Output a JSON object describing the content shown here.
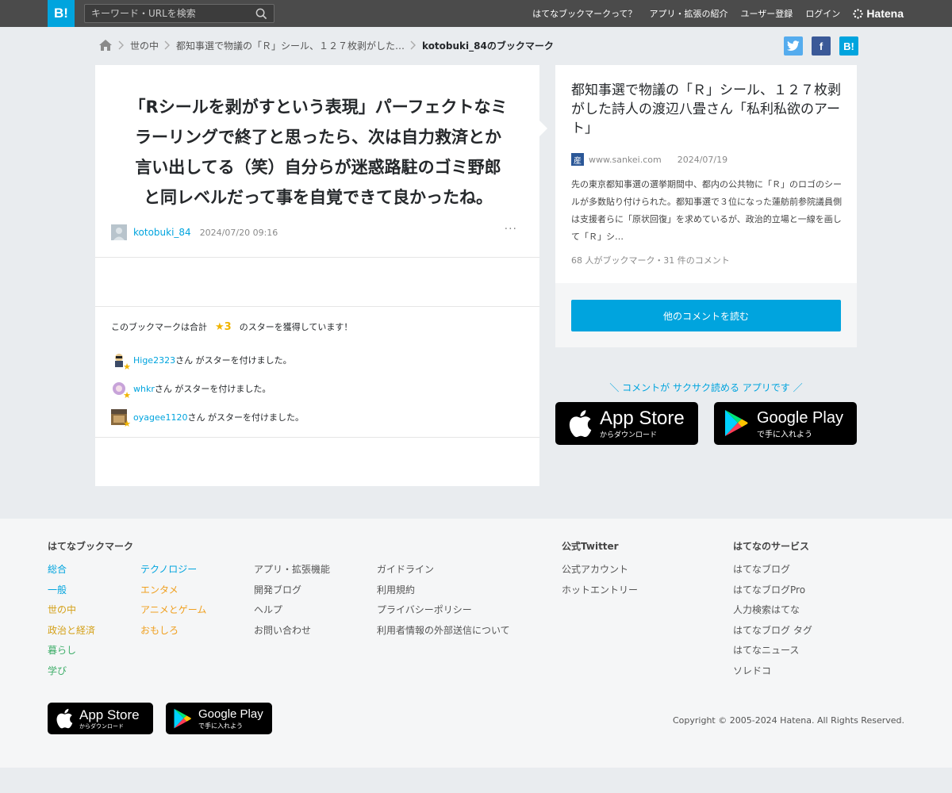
{
  "header": {
    "logo": "B!",
    "search_placeholder": "キーワード・URLを検索",
    "nav": [
      "はてなブックマークって？",
      "アプリ・拡張の紹介",
      "ユーザー登録",
      "ログイン"
    ],
    "brand": "Hatena"
  },
  "breadcrumb": {
    "items": [
      "世の中",
      "都知事選で物議の「Ｒ」シール、１２７枚剥がした…"
    ],
    "current": "kotobuki_84のブックマーク"
  },
  "share": {
    "facebook": "f",
    "hatena": "B!"
  },
  "comment": {
    "text": "「Rシールを剥がすという表現」パーフェクトなミラーリングで終了と思ったら、次は自力救済とか言い出してる（笑）自分らが迷惑路駐のゴミ野郎と同レベルだって事を自覚できて良かったね。",
    "user": "kotobuki_84",
    "timestamp": "2024/07/20 09:16",
    "more": "···"
  },
  "stars": {
    "prefix": "このブックマークは合計",
    "count": "★3",
    "suffix": "のスターを獲得しています！",
    "star_suffix": "さん がスターを付けました。",
    "givers": [
      {
        "user": "Hige2323"
      },
      {
        "user": "whkr"
      },
      {
        "user": "oyagee1120"
      }
    ]
  },
  "entry": {
    "title": "都知事選で物議の「Ｒ」シール、１２７枚剥がした詩人の渡辺八畳さん「私利私欲のアート」",
    "domain": "www.sankei.com",
    "date": "2024/07/19",
    "description": "先の東京都知事選の選挙期間中、都内の公共物に「Ｒ」のロゴのシールが多数貼り付けられた。都知事選で３位になった蓮舫前参院議員側は支援者らに「原状回復」を求めているが、政治的立場と一線を画して「Ｒ」シ…",
    "stats": "68 人がブックマーク・31 件のコメント"
  },
  "read_button": "他のコメントを読む",
  "promo": "＼ コメントが サクサク読める アプリです ／",
  "app_store": {
    "name": "App Store",
    "sub": "からダウンロード"
  },
  "google_play": {
    "name": "Google Play",
    "sub": "で手に入れよう"
  },
  "footer": {
    "col1_title": "はてなブックマーク",
    "col1a": [
      "総合",
      "一般",
      "世の中",
      "政治と経済",
      "暮らし",
      "学び"
    ],
    "col1b": [
      "テクノロジー",
      "エンタメ",
      "アニメとゲーム",
      "おもしろ"
    ],
    "col2": [
      "アプリ・拡張機能",
      "開発ブログ",
      "ヘルプ",
      "お問い合わせ"
    ],
    "col3": [
      "ガイドライン",
      "利用規約",
      "プライバシーポリシー",
      "利用者情報の外部送信について"
    ],
    "twitter_title": "公式Twitter",
    "twitter": [
      "公式アカウント",
      "ホットエントリー"
    ],
    "services_title": "はてなのサービス",
    "services": [
      "はてなブログ",
      "はてなブログPro",
      "人力検索はてな",
      "はてなブログ タグ",
      "はてなニュース",
      "ソレドコ"
    ],
    "copyright": "Copyright © 2005-2024 Hatena. All Rights Reserved."
  },
  "colors": {
    "accent": "#00a4de",
    "header_bg": "#4b4b4b",
    "star": "#f0b400",
    "twitter": "#55acee",
    "facebook": "#3b5998",
    "category_colors": [
      "#00a4de",
      "#00a4de",
      "#d4a017",
      "#d4a017",
      "#3fae6a",
      "#3fae6a"
    ]
  }
}
